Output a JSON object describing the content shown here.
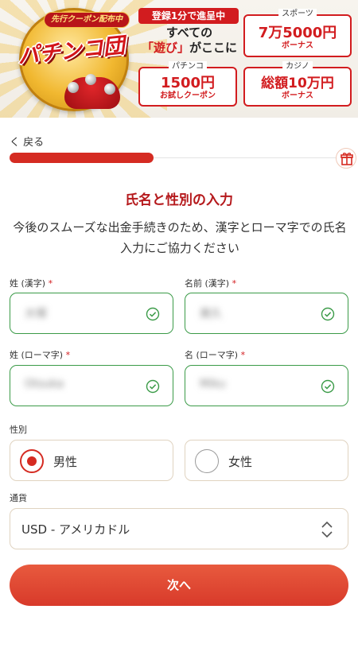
{
  "banner": {
    "badge": "先行クーポン配布中",
    "logo": "パチンコ団",
    "headline_tag": "登録1分で進呈中",
    "headline_line1": "すべての",
    "headline_line2_red": "「遊び」",
    "headline_line2_rest": "がここに",
    "promos": [
      {
        "label": "スポーツ",
        "amount": "7万5000円",
        "sub": "ボーナス"
      },
      {
        "label": "パチンコ",
        "amount": "1500円",
        "sub": "お試しクーポン"
      },
      {
        "label": "カジノ",
        "amount": "総額10万円",
        "sub": "ボーナス"
      }
    ]
  },
  "nav": {
    "back_label": "く 戻る",
    "progress": 0.44
  },
  "form": {
    "title": "氏名と性別の入力",
    "description": "今後のスムーズな出金手続きのため、漢字とローマ字での氏名入力にご協力ください",
    "required_mark": "*",
    "last_name_kanji": {
      "label": "姓 (漢字)",
      "value": "大塚"
    },
    "first_name_kanji": {
      "label": "名前 (漢字)",
      "value": "美久"
    },
    "last_name_roman": {
      "label": "姓 (ローマ字)",
      "value": "Otsuka"
    },
    "first_name_roman": {
      "label": "名 (ローマ字)",
      "value": "Miku"
    },
    "gender": {
      "label": "性別",
      "options": [
        "男性",
        "女性"
      ],
      "selected": "男性"
    },
    "currency": {
      "label": "通貨",
      "value": "USD - アメリカドル"
    },
    "next_label": "次へ"
  },
  "colors": {
    "accent": "#d52b22",
    "valid": "#3b9b48",
    "title": "#b5191c"
  }
}
